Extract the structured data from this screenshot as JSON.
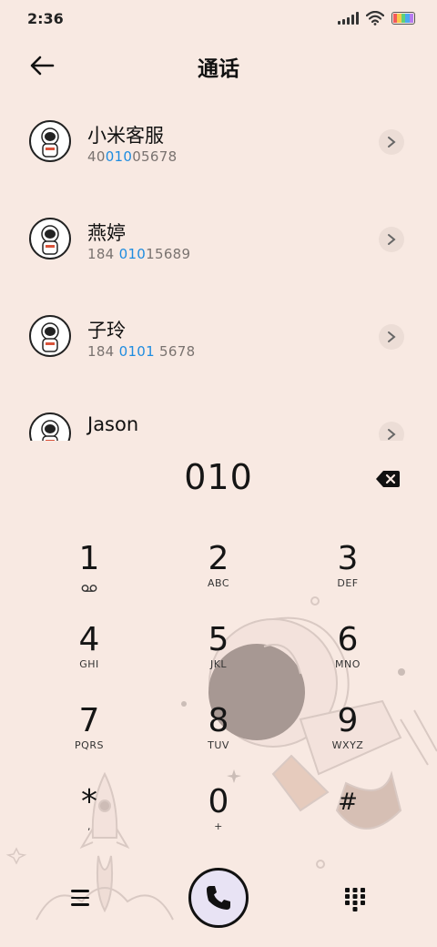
{
  "status_bar": {
    "time": "2:36",
    "icons": [
      "signal-icon",
      "wifi-icon",
      "battery-icon"
    ],
    "battery_colors": [
      "#f35a5a",
      "#f7c94a",
      "#5fd17a",
      "#4aa9f0",
      "#b57cf0"
    ]
  },
  "header": {
    "title": "通话",
    "back_icon": "back-arrow-icon"
  },
  "contacts": [
    {
      "name": "小米客服",
      "number_parts": [
        "40",
        "010",
        "05678"
      ]
    },
    {
      "name": "燕婷",
      "number_parts": [
        "184 ",
        "010",
        "15689"
      ]
    },
    {
      "name": "子玲",
      "number_parts": [
        "184 ",
        "0101",
        " 5678"
      ]
    },
    {
      "name": "Jason",
      "number_parts": [
        "",
        "",
        ""
      ]
    }
  ],
  "dialer": {
    "number": "010",
    "backspace_icon": "backspace-icon"
  },
  "keypad": [
    {
      "digit": "1",
      "letters": "voicemail-icon"
    },
    {
      "digit": "2",
      "letters": "ABC"
    },
    {
      "digit": "3",
      "letters": "DEF"
    },
    {
      "digit": "4",
      "letters": "GHI"
    },
    {
      "digit": "5",
      "letters": "JKL"
    },
    {
      "digit": "6",
      "letters": "MNO"
    },
    {
      "digit": "7",
      "letters": "PQRS"
    },
    {
      "digit": "8",
      "letters": "TUV"
    },
    {
      "digit": "9",
      "letters": "WXYZ"
    },
    {
      "digit": "*",
      "letters": ","
    },
    {
      "digit": "0",
      "letters": "+"
    },
    {
      "digit": "#",
      "letters": ""
    }
  ],
  "bottom_bar": {
    "menu_icon": "menu-icon",
    "call_icon": "phone-icon",
    "keypad_icon": "dialpad-icon"
  },
  "colors": {
    "background": "#f8e9e2",
    "highlight": "#1e8ce0",
    "call_button": "#e8e3f4"
  }
}
